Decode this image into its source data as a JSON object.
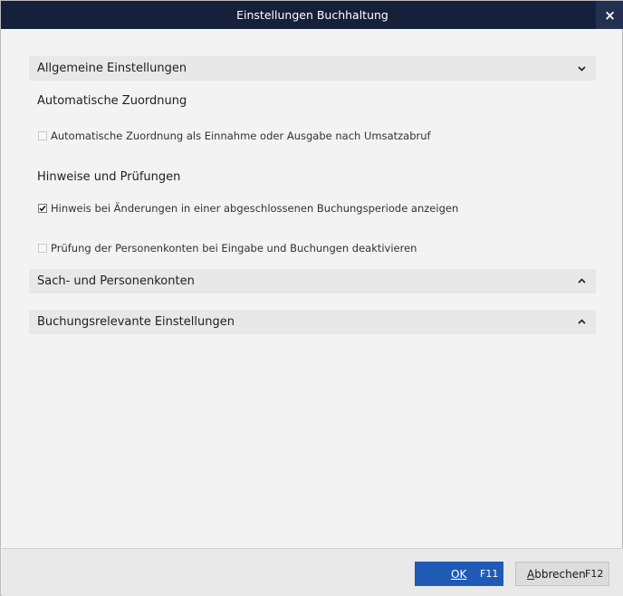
{
  "window": {
    "title": "Einstellungen Buchhaltung",
    "close_glyph": "×"
  },
  "sections": {
    "general": {
      "label": "Allgemeine Einstellungen",
      "expanded": true,
      "groups": {
        "auto": {
          "title": "Automatische Zuordnung",
          "options": [
            {
              "label": "Automatische Zuordnung als Einnahme oder Ausgabe nach Umsatzabruf",
              "checked": false
            }
          ]
        },
        "hints": {
          "title": "Hinweise und Prüfungen",
          "options": [
            {
              "label": "Hinweis bei Änderungen in einer abgeschlossenen Buchungsperiode anzeigen",
              "checked": true
            },
            {
              "label": "Prüfung der Personenkonten bei Eingabe und Buchungen deaktivieren",
              "checked": false
            }
          ]
        }
      }
    },
    "accounts": {
      "label": "Sach- und Personenkonten",
      "expanded": false
    },
    "booking": {
      "label": "Buchungsrelevante Einstellungen",
      "expanded": false
    }
  },
  "footer": {
    "ok": {
      "label": "OK",
      "shortcut": "F11"
    },
    "cancel": {
      "label_first": "A",
      "label_rest": "bbrechen",
      "shortcut": "F12"
    }
  },
  "colors": {
    "titlebar": "#15203a",
    "ok_button": "#1f5bb5",
    "section_header": "#e8e8e8"
  }
}
